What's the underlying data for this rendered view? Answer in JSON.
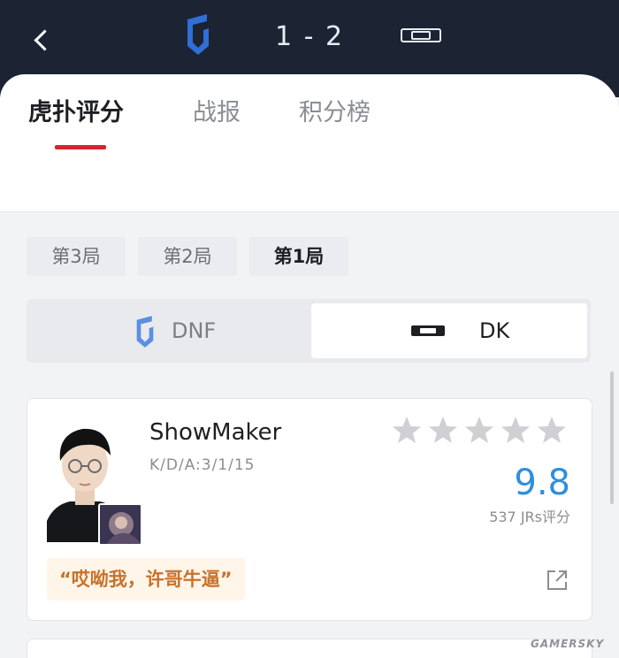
{
  "header": {
    "score": "1 - 2",
    "left_team_logo": "dnf-shield-icon",
    "right_team_logo": "dk-logo-icon",
    "colors": {
      "background": "#1c2333",
      "text": "#e9ecf2"
    }
  },
  "tabs": [
    {
      "label": "虎扑评分",
      "active": true
    },
    {
      "label": "战报",
      "active": false
    },
    {
      "label": "积分榜",
      "active": false
    }
  ],
  "games": [
    {
      "label": "第3局",
      "active": false
    },
    {
      "label": "第2局",
      "active": false
    },
    {
      "label": "第1局",
      "active": true
    }
  ],
  "teams": [
    {
      "label": "DNF",
      "icon": "dnf-shield-icon",
      "selected": false
    },
    {
      "label": "DK",
      "icon": "dk-logo-icon",
      "selected": true
    }
  ],
  "player": {
    "name": "ShowMaker",
    "kda": "K/D/A:3/1/15",
    "stars_filled": 0,
    "stars_total": 5,
    "rating": "9.8",
    "rating_count": "537 JRs评分",
    "comment": "“哎呦我，许哥牛逼”"
  },
  "accent": {
    "active_tab": "#d6242e",
    "rating": "#2e8fdc",
    "comment": "#c9712a",
    "dnf_blue": "#2f6fd6"
  },
  "watermark": "GAMERSKY"
}
